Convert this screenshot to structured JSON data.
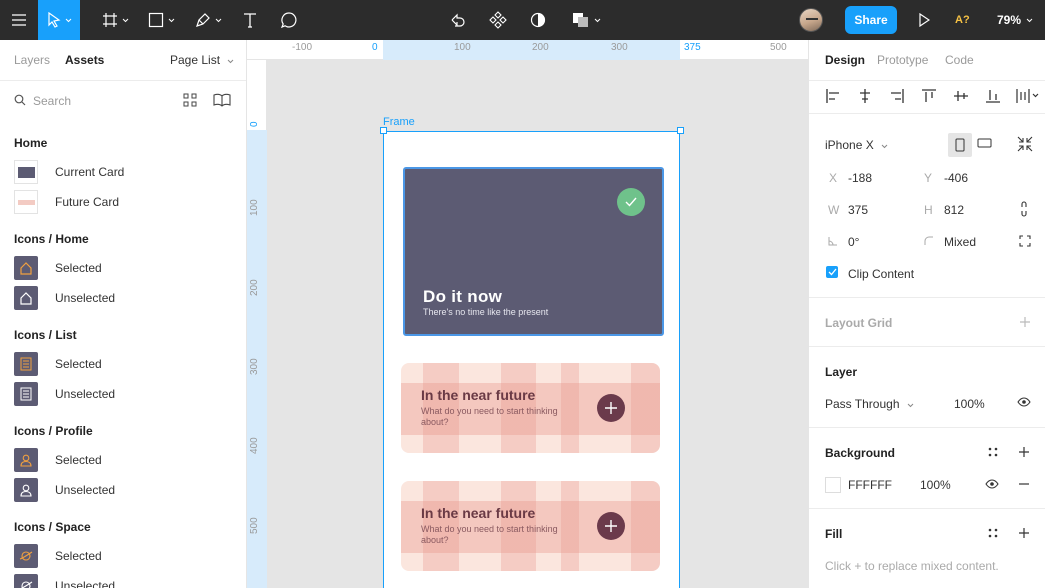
{
  "toolbar": {
    "share_label": "Share",
    "a11y_label": "A?",
    "zoom": "79%"
  },
  "left_panel": {
    "tabs": [
      "Layers",
      "Assets"
    ],
    "page_list": "Page List",
    "search_placeholder": "Search",
    "sections": [
      {
        "title": "Home",
        "items": [
          "Current Card",
          "Future Card"
        ]
      },
      {
        "title": "Icons / Home",
        "items": [
          "Selected",
          "Unselected"
        ]
      },
      {
        "title": "Icons / List",
        "items": [
          "Selected",
          "Unselected"
        ]
      },
      {
        "title": "Icons / Profile",
        "items": [
          "Selected",
          "Unselected"
        ]
      },
      {
        "title": "Icons / Space",
        "items": [
          "Selected",
          "Unselected"
        ]
      }
    ]
  },
  "rulers": {
    "top": [
      "-100",
      "0",
      "100",
      "200",
      "300",
      "375",
      "500"
    ],
    "left": [
      "0",
      "100",
      "200",
      "300",
      "400",
      "500"
    ]
  },
  "canvas": {
    "frame_label": "Frame",
    "card_now": {
      "title": "Do it now",
      "subtitle": "There's no time like the present"
    },
    "card_future_1": {
      "title": "In the near future",
      "subtitle": "What do you need to start thinking about?"
    },
    "card_future_2": {
      "title": "In the near future",
      "subtitle": "What do you need to start thinking about?"
    }
  },
  "right_panel": {
    "tabs": [
      "Design",
      "Prototype",
      "Code"
    ],
    "device": "iPhone X",
    "x_label": "X",
    "x_value": "-188",
    "y_label": "Y",
    "y_value": "-406",
    "w_label": "W",
    "w_value": "375",
    "h_label": "H",
    "h_value": "812",
    "rotation": "0°",
    "radius": "Mixed",
    "clip_content": "Clip Content",
    "layout_grid": "Layout Grid",
    "layer_title": "Layer",
    "blend_mode": "Pass Through",
    "layer_opacity": "100%",
    "background_title": "Background",
    "bg_hex": "FFFFFF",
    "bg_opacity": "100%",
    "fill_title": "Fill",
    "fill_hint": "Click + to replace mixed content."
  },
  "colors": {
    "accent": "#18a0fb",
    "toolbar_bg": "#2c2c2c",
    "card_now_bg": "#5c5b73",
    "check_green": "#6fc28b",
    "plus_bg": "#6b3a4b"
  }
}
